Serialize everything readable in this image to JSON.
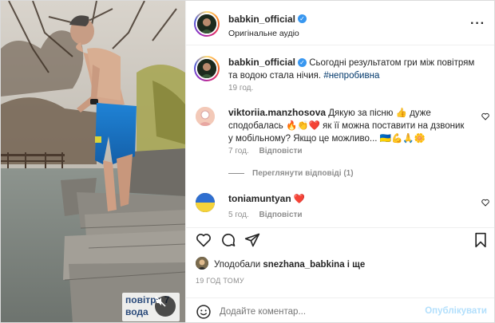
{
  "post": {
    "username": "babkin_official",
    "audio": "Оригінальне аудіо",
    "more_icon": "more-horizontal-icon",
    "video_overlay_text": [
      "повітря 7",
      "вода"
    ],
    "mute_icon": "speaker-muted-icon"
  },
  "caption": {
    "username": "babkin_official",
    "text": "Сьогодні результатом гри між повітрям та водою стала нічия.",
    "hashtag": "#непробивна",
    "time": "19 год."
  },
  "comments": [
    {
      "username": "viktoriia.manzhosova",
      "text": "Дякую за пісню 👍 дуже сподобалась 🔥👏❤️ як її можна поставити на дзвоник у мобільному? Якщо це можливо... 🇺🇦💪🙏🌼",
      "time": "7 год.",
      "reply": "Відповісти"
    },
    {
      "username": "toniamuntyan",
      "text": "❤️",
      "time": "5 год.",
      "reply": "Відповісти"
    }
  ],
  "view_replies": "Переглянути відповіді (1)",
  "likes": {
    "prefix": "Уподобали",
    "user": "snezhana_babkina",
    "suffix": "і ще"
  },
  "post_time": "19 ГОД ТОМУ",
  "add_comment": {
    "placeholder": "Додайте коментар...",
    "publish": "Опублікувати"
  },
  "colors": {
    "link": "#00376b",
    "publish": "#b2dffc",
    "verified": "#3897f0"
  }
}
